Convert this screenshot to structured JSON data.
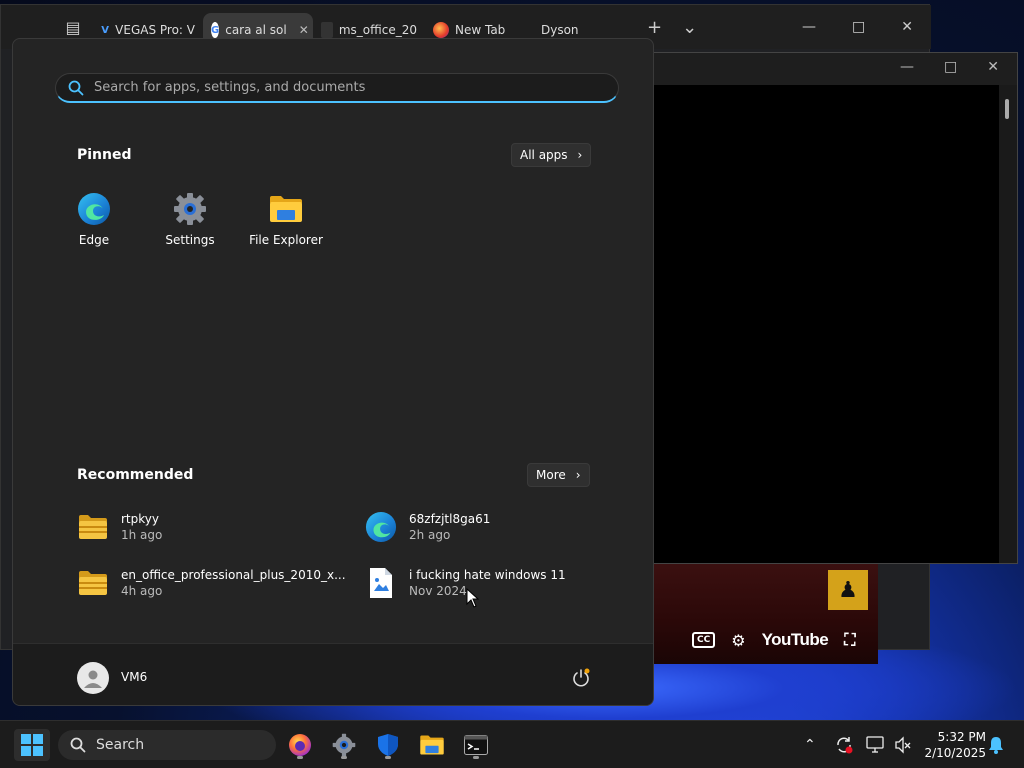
{
  "browser": {
    "tabs": [
      {
        "label": "VEGAS Pro: V",
        "favicon": "V"
      },
      {
        "label": "cara al sol",
        "favicon": "G",
        "active": true
      },
      {
        "label": "ms_office_20",
        "favicon": ""
      },
      {
        "label": "New Tab",
        "favicon": ""
      },
      {
        "label": "Dyson",
        "favicon": ""
      }
    ]
  },
  "video": {
    "logo": "YouTube",
    "cc": "CC"
  },
  "start_menu": {
    "search_placeholder": "Search for apps, settings, and documents",
    "pinned_title": "Pinned",
    "all_apps_label": "All apps",
    "pinned": [
      {
        "label": "Edge",
        "icon": "edge-icon"
      },
      {
        "label": "Settings",
        "icon": "settings-gear-icon"
      },
      {
        "label": "File Explorer",
        "icon": "folder-icon"
      }
    ],
    "recommended_title": "Recommended",
    "more_label": "More",
    "recommended": [
      {
        "name": "rtpkyy",
        "time": "1h ago",
        "icon": "zip-folder-icon"
      },
      {
        "name": "68zfzjtl8ga61",
        "time": "2h ago",
        "icon": "edge-icon"
      },
      {
        "name": "en_office_professional_plus_2010_x...",
        "time": "4h ago",
        "icon": "zip-folder-icon"
      },
      {
        "name": "i fucking hate windows 11",
        "time": "Nov 2024",
        "icon": "image-file-icon"
      }
    ],
    "user": "VM6"
  },
  "taskbar": {
    "search_label": "Search",
    "time": "5:32 PM",
    "date": "2/10/2025"
  },
  "colors": {
    "accent": "#4cc2ff",
    "start_bg": "#242424",
    "taskbar_bg": "#1c1c1c"
  }
}
